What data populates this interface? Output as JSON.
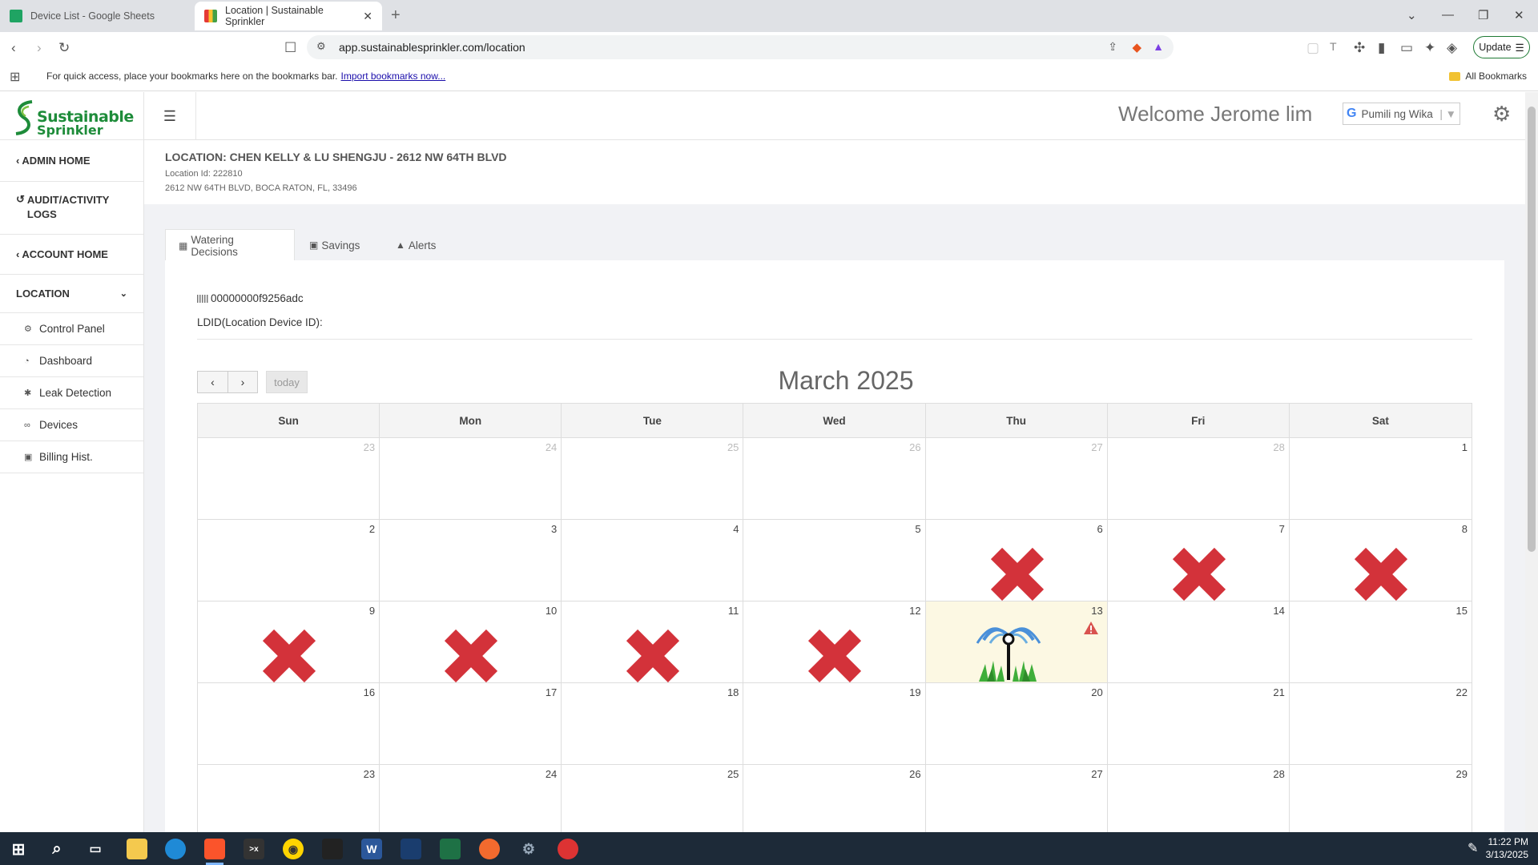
{
  "browser": {
    "tabs": [
      {
        "title": "Device List - Google Sheets",
        "active": false
      },
      {
        "title": "Location | Sustainable Sprinkler",
        "active": true
      }
    ],
    "url": "app.sustainablesprinkler.com/location",
    "update_label": "Update",
    "bookmarks_msg": "For quick access, place your bookmarks here on the bookmarks bar.",
    "bookmarks_link": "Import bookmarks now...",
    "all_bookmarks": "All Bookmarks"
  },
  "logo": {
    "line1": "Sustainable",
    "line2": "Sprinkler"
  },
  "sidebar": {
    "admin_home": "ADMIN HOME",
    "audit_logs_1": "AUDIT/ACTIVITY",
    "audit_logs_2": "LOGS",
    "account_home": "ACCOUNT HOME",
    "location": "LOCATION",
    "items": [
      {
        "label": "Control Panel",
        "icon": "cogs-icon"
      },
      {
        "label": "Dashboard",
        "icon": "dashboard-icon"
      },
      {
        "label": "Leak Detection",
        "icon": "asterisk-icon"
      },
      {
        "label": "Devices",
        "icon": "link-icon"
      },
      {
        "label": "Billing Hist.",
        "icon": "money-icon"
      }
    ]
  },
  "header": {
    "welcome": "Welcome Jerome lim",
    "language": "Pumili ng Wika"
  },
  "location": {
    "title": "LOCATION: CHEN KELLY & LU SHENGJU - 2612 NW 64TH BLVD",
    "id": "Location Id: 222810",
    "address": "2612 NW 64TH BLVD, BOCA RATON, FL, 33496"
  },
  "tabs": {
    "watering": "Watering Decisions",
    "savings": "Savings",
    "alerts": "Alerts"
  },
  "device": {
    "serial": "00000000f9256adc",
    "ldid": "LDID(Location Device ID):"
  },
  "calendar": {
    "today_label": "today",
    "month": "March 2025",
    "days_of_week": [
      "Sun",
      "Mon",
      "Tue",
      "Wed",
      "Thu",
      "Fri",
      "Sat"
    ],
    "weeks": [
      [
        {
          "d": "23",
          "o": true
        },
        {
          "d": "24",
          "o": true
        },
        {
          "d": "25",
          "o": true
        },
        {
          "d": "26",
          "o": true
        },
        {
          "d": "27",
          "o": true
        },
        {
          "d": "28",
          "o": true
        },
        {
          "d": "1"
        }
      ],
      [
        {
          "d": "2"
        },
        {
          "d": "3"
        },
        {
          "d": "4"
        },
        {
          "d": "5"
        },
        {
          "d": "6",
          "m": "skip"
        },
        {
          "d": "7",
          "m": "skip"
        },
        {
          "d": "8",
          "m": "skip"
        }
      ],
      [
        {
          "d": "9",
          "m": "skip"
        },
        {
          "d": "10",
          "m": "skip"
        },
        {
          "d": "11",
          "m": "skip"
        },
        {
          "d": "12",
          "m": "skip"
        },
        {
          "d": "13",
          "m": "water",
          "today": true,
          "alert": true
        },
        {
          "d": "14"
        },
        {
          "d": "15"
        }
      ],
      [
        {
          "d": "16"
        },
        {
          "d": "17"
        },
        {
          "d": "18"
        },
        {
          "d": "19"
        },
        {
          "d": "20"
        },
        {
          "d": "21"
        },
        {
          "d": "22"
        }
      ],
      [
        {
          "d": "23"
        },
        {
          "d": "24"
        },
        {
          "d": "25"
        },
        {
          "d": "26"
        },
        {
          "d": "27"
        },
        {
          "d": "28"
        },
        {
          "d": "29"
        }
      ]
    ]
  },
  "taskbar": {
    "time": "11:22 PM",
    "date": "3/13/2025"
  },
  "colors": {
    "brand_green": "#1e8c3a",
    "skip_red": "#d3323a",
    "today_bg": "#fcf8e3",
    "alert_red": "#d9534f"
  }
}
